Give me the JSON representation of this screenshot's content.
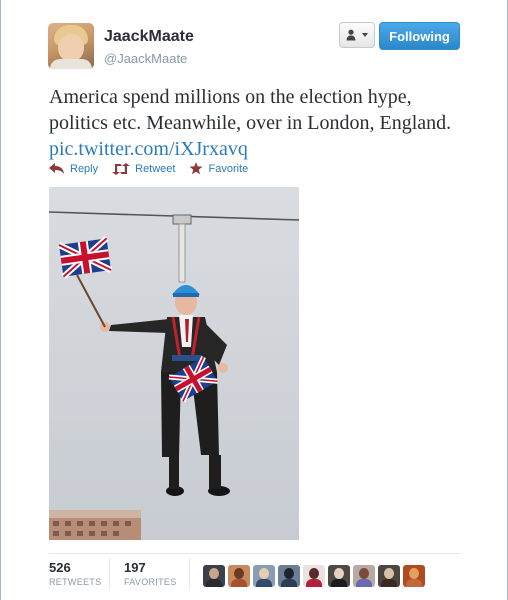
{
  "user": {
    "display_name": "JaackMaate",
    "handle": "@JaackMaate"
  },
  "buttons": {
    "follow_label": "Following"
  },
  "tweet": {
    "text": "America spend millions on the election hype, politics etc. Meanwhile, over in London, England.",
    "link": "pic.twitter.com/iXJrxavq"
  },
  "actions": {
    "reply": "Reply",
    "retweet": "Retweet",
    "favorite": "Favorite"
  },
  "stats": {
    "retweets_count": "526",
    "retweets_label": "RETWEETS",
    "favorites_count": "197",
    "favorites_label": "FAVORITES"
  },
  "favoriters": [
    {
      "bg": "#3d3f4a",
      "head": "#c7a48a",
      "body": "#2a2a33"
    },
    {
      "bg": "#c98b5e",
      "head": "#6b3a22",
      "body": "#a4532e"
    },
    {
      "bg": "#8a9bb5",
      "head": "#e8cdb5",
      "body": "#344a6a"
    },
    {
      "bg": "#6a7f95",
      "head": "#1e2430",
      "body": "#2f3d52"
    },
    {
      "bg": "#e9e2e0",
      "head": "#5a2a2a",
      "body": "#b0203a"
    },
    {
      "bg": "#4d4a44",
      "head": "#e5d3c0",
      "body": "#1c1c1c"
    },
    {
      "bg": "#b9a9a5",
      "head": "#7a4a3a",
      "body": "#6a6ab0"
    },
    {
      "bg": "#4a4540",
      "head": "#d8c1a8",
      "body": "#3a2a20"
    },
    {
      "bg": "#b04a20",
      "head": "#e0a060",
      "body": "#c06a3a"
    }
  ],
  "colors": {
    "link": "#2b7bb9",
    "follow_button": "#2b87c9",
    "text": "#292f33",
    "muted": "#8899a6"
  }
}
